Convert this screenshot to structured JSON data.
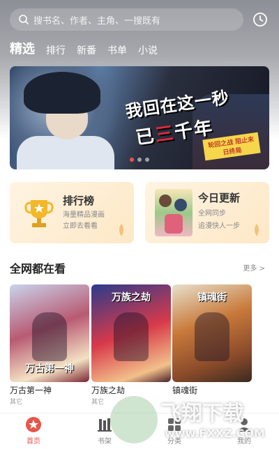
{
  "search": {
    "placeholder": "搜书名、作者、主角、一搜既有"
  },
  "tabs": [
    {
      "label": "精选",
      "active": true
    },
    {
      "label": "排行"
    },
    {
      "label": "新番"
    },
    {
      "label": "书单"
    },
    {
      "label": "小说"
    }
  ],
  "banner": {
    "title_line1": "我回在这一秒",
    "title_line2_part1": "已",
    "title_line2_red": "三",
    "title_line2_part2": "千年",
    "tag": "轮回之战 阻止末日终局",
    "slide_count": 3,
    "active_slide": 0
  },
  "cards": {
    "rank": {
      "title": "排行榜",
      "line1": "海量精品漫画",
      "line2": "立即去看看"
    },
    "today": {
      "title": "今日更新",
      "line1": "全网同步",
      "line2": "追漫快人一步"
    }
  },
  "section": {
    "title": "全网都在看",
    "more": "更多 >"
  },
  "comics": [
    {
      "cover_text": "万古第一神",
      "name": "万古第一神",
      "tag": "其它"
    },
    {
      "cover_text": "万族之劫",
      "name": "万族之劫",
      "tag": "其它"
    },
    {
      "cover_text": "镇魂街",
      "name": "镇魂街",
      "tag": ""
    }
  ],
  "nav": [
    {
      "label": "首页",
      "icon": "home-icon",
      "active": true
    },
    {
      "label": "书架",
      "icon": "bookshelf-icon"
    },
    {
      "label": "分类",
      "icon": "category-icon"
    },
    {
      "label": "我的",
      "icon": "profile-icon"
    }
  ],
  "watermark": {
    "text": "飞翔下载",
    "url": "www.FXXZ.COM"
  },
  "colors": {
    "accent": "#e8554a",
    "card_bg": "#fde8c6"
  }
}
